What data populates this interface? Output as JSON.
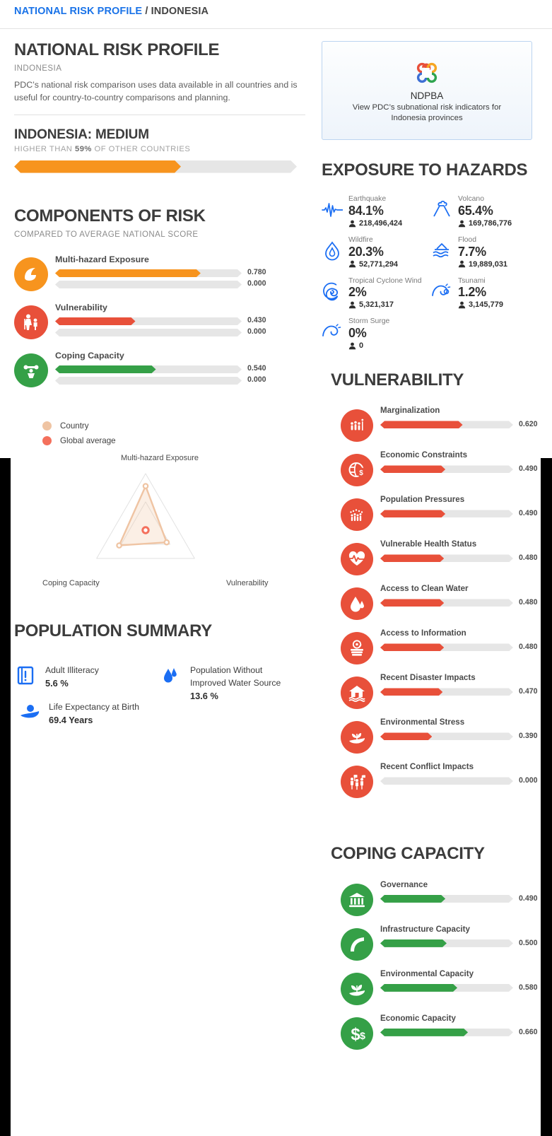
{
  "breadcrumb": {
    "link": "NATIONAL RISK PROFILE",
    "separator": "/",
    "current": "INDONESIA"
  },
  "colors": {
    "accent_blue": "#1a73e8",
    "orange": "#f7941e",
    "red": "#e8503a",
    "green": "#35a047",
    "track": "#e6e6e6",
    "country": "#efc4a3",
    "global_average": "#f4705c"
  },
  "header": {
    "title": "NATIONAL RISK PROFILE",
    "country": "INDONESIA",
    "description": "PDC’s national risk comparison uses data available in all countries and is useful for country-to-country comparisons and planning."
  },
  "risk_level": {
    "title": "INDONESIA: MEDIUM",
    "sub_prefix": "HIGHER THAN ",
    "sub_value": "59%",
    "sub_suffix": " OF OTHER COUNTRIES",
    "percent": 59
  },
  "components": {
    "title": "COMPONENTS OF RISK",
    "subtitle": "COMPARED TO AVERAGE NATIONAL SCORE",
    "rows": [
      {
        "label": "Multi-hazard Exposure",
        "value": "0.780",
        "value_num": 0.78,
        "average": "0.000",
        "average_num": 0.0,
        "color": "#f7941e",
        "icon": "wave-icon"
      },
      {
        "label": "Vulnerability",
        "value": "0.430",
        "value_num": 0.43,
        "average": "0.000",
        "average_num": 0.0,
        "color": "#e8503a",
        "icon": "family-icon"
      },
      {
        "label": "Coping Capacity",
        "value": "0.540",
        "value_num": 0.54,
        "average": "0.000",
        "average_num": 0.0,
        "color": "#35a047",
        "icon": "person-lifting-icon"
      }
    ]
  },
  "chart_data": {
    "type": "radar",
    "title": "",
    "axes": [
      "Multi-hazard Exposure",
      "Vulnerability",
      "Coping Capacity"
    ],
    "legend": [
      {
        "name": "Country",
        "color": "#efc4a3"
      },
      {
        "name": "Global average",
        "color": "#f4705c"
      }
    ],
    "legend_position": "top-left",
    "rmax": 1.0,
    "grid": true,
    "grid_rings": [
      0.5,
      1.0
    ],
    "series": [
      {
        "name": "Country",
        "values": [
          0.78,
          0.43,
          0.54
        ],
        "color": "#efc4a3"
      },
      {
        "name": "Global average",
        "values": [
          0.0,
          0.0,
          0.0
        ],
        "color": "#f4705c"
      }
    ]
  },
  "population_summary": {
    "title": "POPULATION SUMMARY",
    "items": [
      {
        "name": "Adult Illiteracy",
        "value": "5.6 %",
        "icon": "book-alert-icon"
      },
      {
        "name": "Population Without Improved Water Source",
        "value": "13.6 %",
        "icon": "water-drops-icon"
      },
      {
        "name": "Life Expectancy at Birth",
        "value": "69.4 Years",
        "icon": "hand-heart-icon"
      }
    ]
  },
  "ndpba": {
    "title": "NDPBA",
    "description": "View PDC’s subnational risk indicators for Indonesia provinces",
    "logo": "ndpba-flower-logo"
  },
  "exposure": {
    "title": "EXPOSURE TO HAZARDS",
    "hazards": [
      {
        "name": "Earthquake",
        "percent": "84.1%",
        "population": "218,496,424",
        "icon": "seismograph-icon"
      },
      {
        "name": "Volcano",
        "percent": "65.4%",
        "population": "169,786,776",
        "icon": "volcano-icon"
      },
      {
        "name": "Wildfire",
        "percent": "20.3%",
        "population": "52,771,294",
        "icon": "flame-icon"
      },
      {
        "name": "Flood",
        "percent": "7.7%",
        "population": "19,889,031",
        "icon": "flood-icon"
      },
      {
        "name": "Tropical Cyclone Wind",
        "percent": "2%",
        "population": "5,321,317",
        "icon": "cyclone-icon"
      },
      {
        "name": "Tsunami",
        "percent": "1.2%",
        "population": "3,145,779",
        "icon": "tsunami-icon"
      },
      {
        "name": "Storm Surge",
        "percent": "0%",
        "population": "0",
        "icon": "storm-surge-icon"
      }
    ]
  },
  "vulnerability": {
    "title": "VULNERABILITY",
    "color": "#e8503a",
    "rows": [
      {
        "label": "Marginalization",
        "value": "0.620",
        "value_num": 0.62,
        "icon": "crowd-icon"
      },
      {
        "label": "Economic Constraints",
        "value": "0.490",
        "value_num": 0.49,
        "icon": "globe-dollar-icon"
      },
      {
        "label": "Population Pressures",
        "value": "0.490",
        "value_num": 0.49,
        "icon": "population-icon"
      },
      {
        "label": "Vulnerable Health Status",
        "value": "0.480",
        "value_num": 0.48,
        "icon": "heartbeat-icon"
      },
      {
        "label": "Access to Clean Water",
        "value": "0.480",
        "value_num": 0.48,
        "icon": "water-drop-icon"
      },
      {
        "label": "Access to Information",
        "value": "0.480",
        "value_num": 0.48,
        "icon": "at-books-icon"
      },
      {
        "label": "Recent Disaster Impacts",
        "value": "0.470",
        "value_num": 0.47,
        "icon": "flooded-house-icon"
      },
      {
        "label": "Environmental Stress",
        "value": "0.390",
        "value_num": 0.39,
        "icon": "hand-plant-icon"
      },
      {
        "label": "Recent Conflict Impacts",
        "value": "0.000",
        "value_num": 0.0,
        "icon": "protest-icon"
      }
    ]
  },
  "coping_capacity": {
    "title": "COPING CAPACITY",
    "color": "#35a047",
    "rows": [
      {
        "label": "Governance",
        "value": "0.490",
        "value_num": 0.49,
        "icon": "bank-icon"
      },
      {
        "label": "Infrastructure Capacity",
        "value": "0.500",
        "value_num": 0.5,
        "icon": "road-icon"
      },
      {
        "label": "Environmental Capacity",
        "value": "0.580",
        "value_num": 0.58,
        "icon": "hand-leaf-icon"
      },
      {
        "label": "Economic Capacity",
        "value": "0.660",
        "value_num": 0.66,
        "icon": "dollar-icon"
      }
    ]
  }
}
